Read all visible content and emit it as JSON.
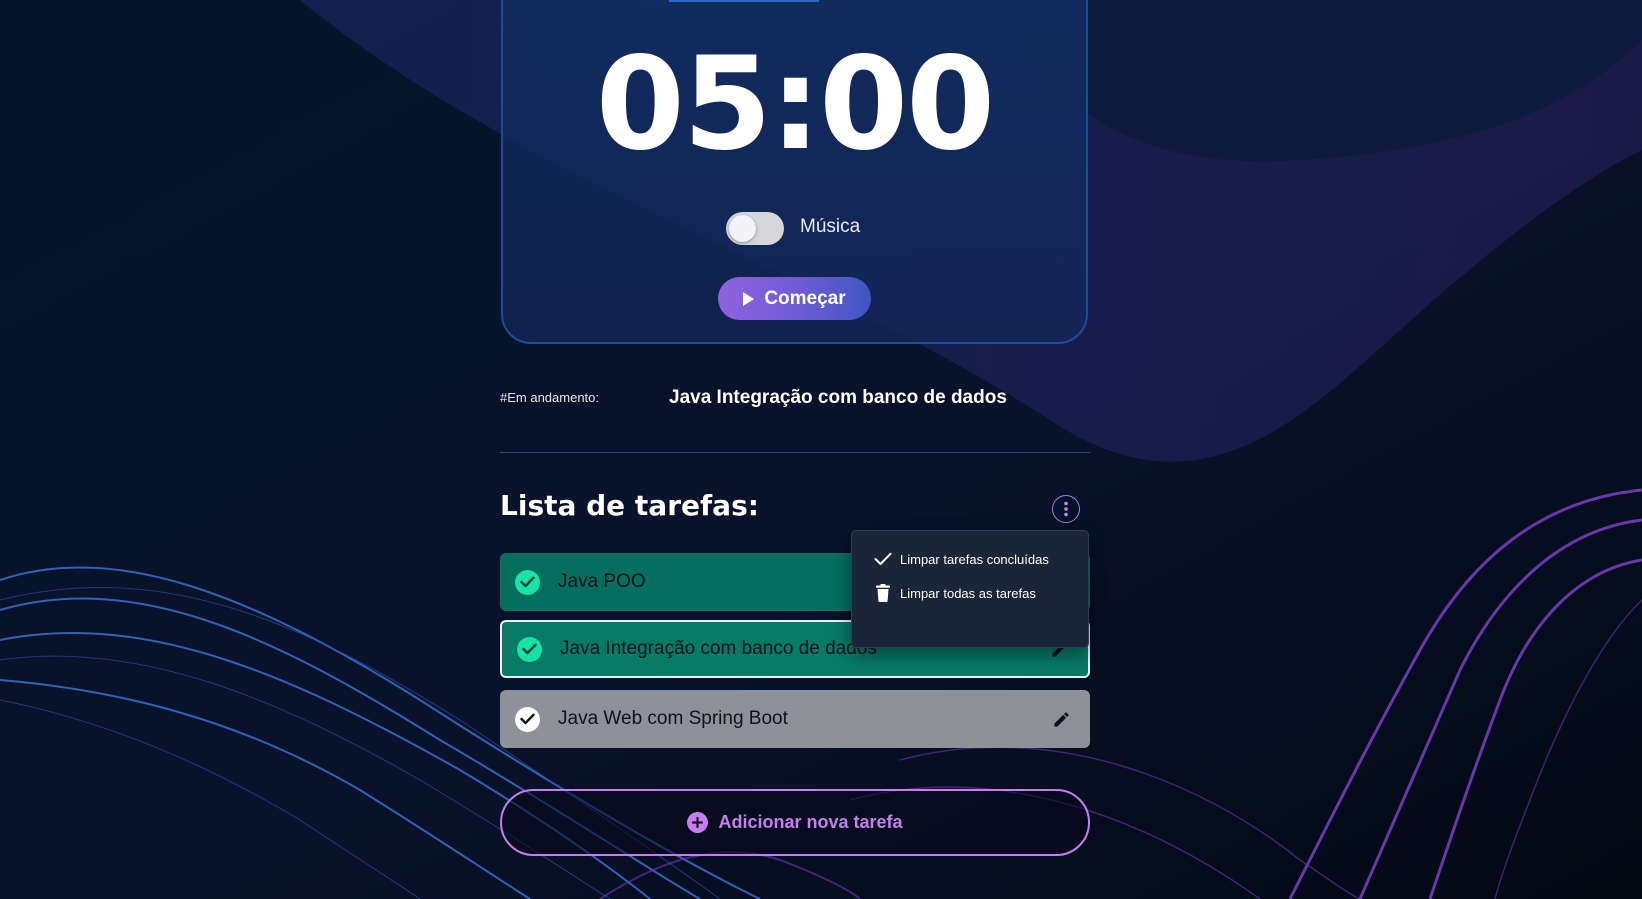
{
  "timer": {
    "display": "05:00"
  },
  "music_toggle": {
    "label": "Música",
    "enabled": false
  },
  "start_button": {
    "label": "Começar",
    "icon": "play-icon"
  },
  "in_progress": {
    "label": "#Em andamento:",
    "task": "Java Integração com banco de dados"
  },
  "task_list": {
    "title": "Lista de tarefas:",
    "menu_icon": "kebab-menu-icon",
    "tasks": [
      {
        "label": "Java POO",
        "completed": true,
        "active": false,
        "icon": "check-icon"
      },
      {
        "label": "Java Integração com banco de dados",
        "completed": true,
        "active": true,
        "icon": "check-icon"
      },
      {
        "label": "Java Web com Spring Boot",
        "completed": false,
        "active": false,
        "icon": "check-icon"
      }
    ]
  },
  "options_menu": {
    "items": [
      {
        "label": "Limpar tarefas concluídas",
        "icon": "check-icon"
      },
      {
        "label": "Limpar todas as tarefas",
        "icon": "trash-icon"
      }
    ]
  },
  "add_task_button": {
    "label": "Adicionar nova tarefa",
    "icon": "plus-circle-icon"
  },
  "colors": {
    "background": "#040c1c",
    "accent_purple": "#c77df2",
    "completed_green": "#056e5e",
    "check_green": "#17e3a2",
    "pending_gray": "#8e9197"
  }
}
